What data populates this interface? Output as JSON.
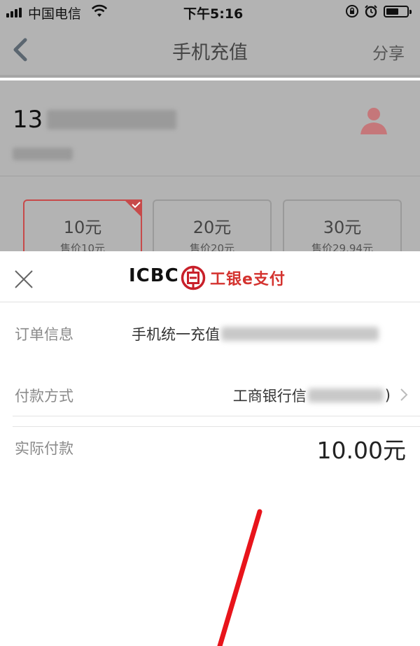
{
  "status_bar": {
    "carrier": "中国电信",
    "time": "下午5:16"
  },
  "nav": {
    "title": "手机充值",
    "share_label": "分享"
  },
  "phone": {
    "number_visible_prefix": "13"
  },
  "amount_options": [
    {
      "face": "10元",
      "price": "售价10元",
      "selected": true
    },
    {
      "face": "20元",
      "price": "售价20元",
      "selected": false
    },
    {
      "face": "30元",
      "price": "售价29.94元",
      "selected": false
    }
  ],
  "payment_sheet": {
    "logo_text": "ICBC",
    "brand_name": "工银e支付",
    "brand_color": "#d4332f",
    "rows": {
      "order_label": "订单信息",
      "order_value": "手机统一充值",
      "method_label": "付款方式",
      "method_value_prefix": "工商银行信",
      "method_value_suffix": ")",
      "actual_label": "实际付款",
      "actual_value": "10.00元"
    }
  },
  "annotation_color": "#e8141b"
}
